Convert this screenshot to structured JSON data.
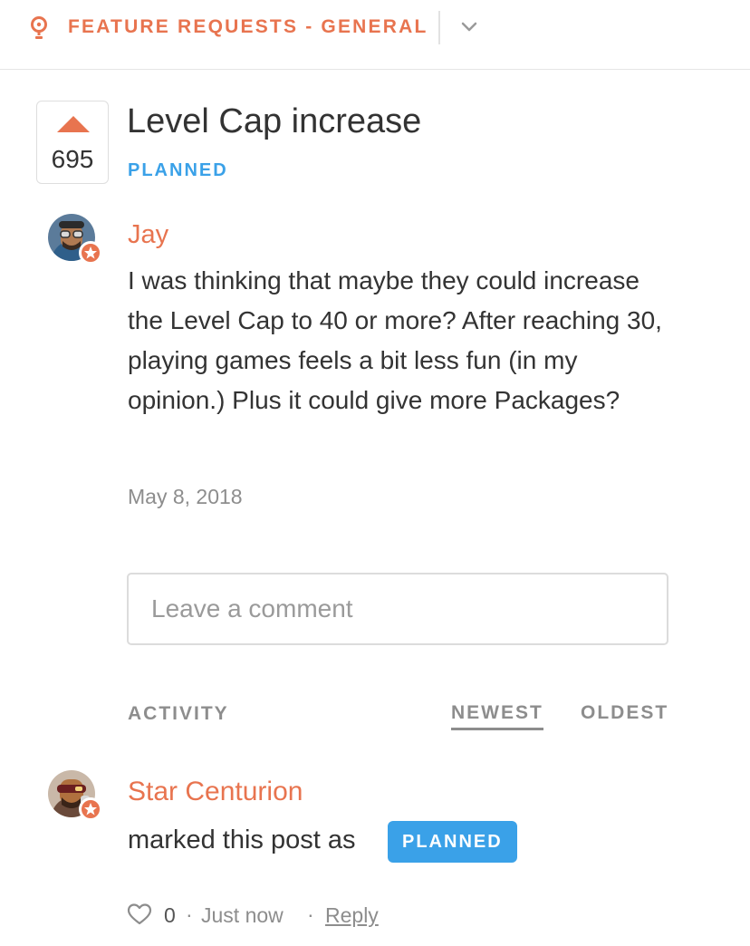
{
  "header": {
    "title": "FEATURE REQUESTS - GENERAL",
    "icon": "lightbulb-icon",
    "dropdown_icon": "chevron-down-icon"
  },
  "post": {
    "votes": "695",
    "title": "Level Cap increase",
    "status": "PLANNED",
    "author": "Jay",
    "body": "I was thinking that maybe they could increase the Level Cap to 40 or more? After reaching 30, playing games feels a bit less fun (in my opinion.) Plus it could give more Packages?",
    "date": "May 8, 2018"
  },
  "comment": {
    "placeholder": "Leave a comment"
  },
  "activity": {
    "label": "ACTIVITY",
    "sort_newest": "NEWEST",
    "sort_oldest": "OLDEST",
    "items": [
      {
        "author": "Star Centurion",
        "text": "marked this post as",
        "status": "PLANNED",
        "likes": "0",
        "separator": "·",
        "time": "Just now",
        "reply": "Reply"
      }
    ]
  },
  "colors": {
    "accent": "#e8744f",
    "status_blue": "#3aa1e8",
    "muted": "#8d8d8d",
    "text": "#333333"
  }
}
